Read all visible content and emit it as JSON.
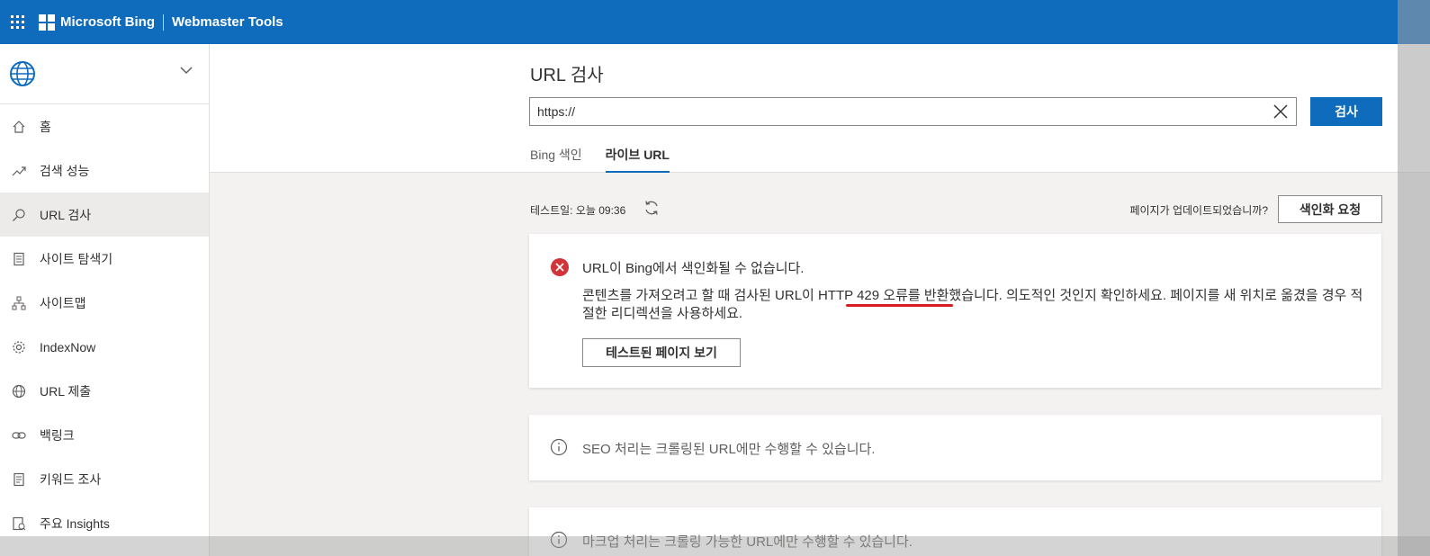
{
  "header": {
    "brand": "Microsoft Bing",
    "product": "Webmaster Tools"
  },
  "sidebar": {
    "items": [
      {
        "label": "홈",
        "icon": "home-icon"
      },
      {
        "label": "검색 성능",
        "icon": "trend-icon"
      },
      {
        "label": "URL 검사",
        "icon": "search-icon",
        "active": true
      },
      {
        "label": "사이트 탐색기",
        "icon": "document-icon"
      },
      {
        "label": "사이트맵",
        "icon": "sitemap-icon"
      },
      {
        "label": "IndexNow",
        "icon": "gear-icon"
      },
      {
        "label": "URL 제출",
        "icon": "globe-icon"
      },
      {
        "label": "백링크",
        "icon": "link-icon"
      },
      {
        "label": "키워드 조사",
        "icon": "document-icon"
      },
      {
        "label": "주요 Insights",
        "icon": "insights-icon"
      }
    ]
  },
  "main": {
    "title": "URL 검사",
    "url_value": "https://",
    "search_label": "검사",
    "tabs": [
      {
        "label": "Bing 색인",
        "active": false
      },
      {
        "label": "라이브 URL",
        "active": true
      }
    ],
    "test_date": "테스트일: 오늘 09:36",
    "updated_question": "페이지가 업데이트되었습니까?",
    "index_request_label": "색인화 요청",
    "error": {
      "title": "URL이 Bing에서 색인화될 수 없습니다.",
      "description": "콘텐츠를 가져오려고 할 때 검사된 URL이 HTTP 429 오류를 반환했습니다. 의도적인 것인지 확인하세요. 페이지를 새 위치로 옮겼을 경우 적절한 리디렉션을 사용하세요.",
      "view_button": "테스트된 페이지 보기"
    },
    "seo_info": "SEO 처리는 크롤링된 URL에만 수행할 수 있습니다.",
    "markup_info": "마크업 처리는 크롤링 가능한 URL에만 수행할 수 있습니다."
  },
  "colors": {
    "brand": "#0f6cbd",
    "error": "#d13438",
    "annotation": "#d81b24"
  }
}
